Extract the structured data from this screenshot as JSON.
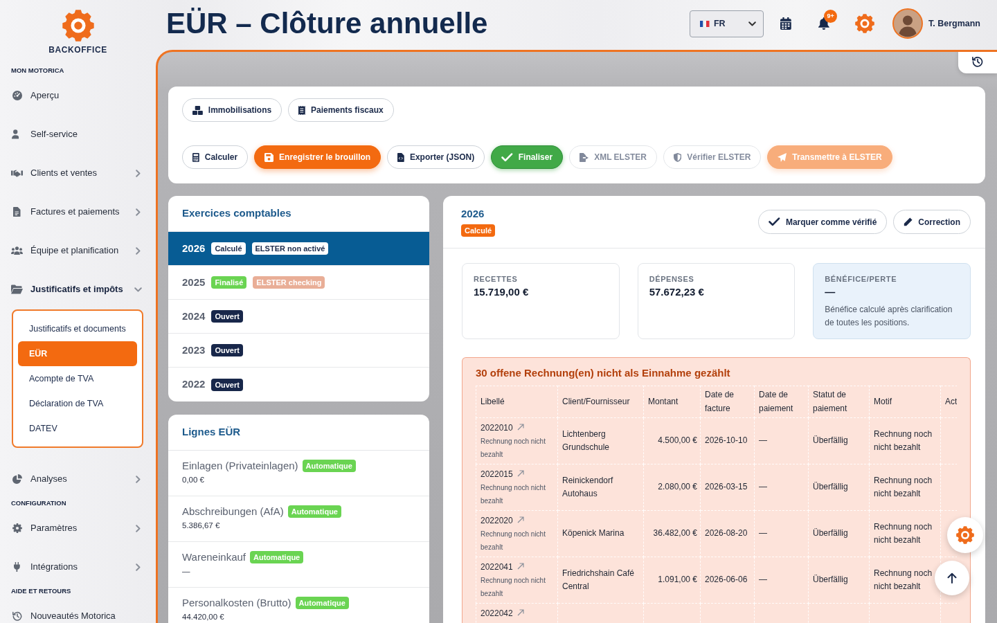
{
  "sidebar": {
    "brand": "BACKOFFICE",
    "sections": [
      {
        "label": "MON MOTORICA",
        "items": [
          {
            "label": "Aperçu",
            "kind": "link"
          },
          {
            "label": "Self-service",
            "kind": "link"
          },
          {
            "label": "Clients et ventes",
            "kind": "menu",
            "expanded": false
          },
          {
            "label": "Factures et paiements",
            "kind": "menu",
            "expanded": false
          },
          {
            "label": "Équipe et planification",
            "kind": "menu",
            "expanded": false
          },
          {
            "label": "Justificatifs et impôts",
            "kind": "menu",
            "expanded": true,
            "children": [
              {
                "label": "Justificatifs et documents",
                "selected": false
              },
              {
                "label": "EÜR",
                "selected": true
              },
              {
                "label": "Acompte de TVA",
                "selected": false
              },
              {
                "label": "Déclaration de TVA",
                "selected": false
              },
              {
                "label": "DATEV",
                "selected": false
              }
            ]
          },
          {
            "label": "Analyses",
            "kind": "menu",
            "expanded": false
          }
        ]
      },
      {
        "label": "CONFIGURATION",
        "items": [
          {
            "label": "Paramètres",
            "kind": "menu",
            "expanded": false
          },
          {
            "label": "Intégrations",
            "kind": "menu",
            "expanded": false
          }
        ]
      },
      {
        "label": "AIDE ET RETOURS",
        "items": [
          {
            "label": "Nouveautés Motorica",
            "kind": "link"
          }
        ]
      }
    ]
  },
  "header": {
    "title": "EÜR – Clôture annuelle",
    "language": "FR",
    "notifications_badge": "9+",
    "user_name": "T. Bergmann"
  },
  "toolbar": {
    "rows": [
      {
        "buttons": [
          {
            "label": "Immobilisations",
            "kind": "outline",
            "disabled": false
          },
          {
            "label": "Paiements fiscaux",
            "kind": "outline",
            "disabled": false
          }
        ]
      },
      {
        "buttons": [
          {
            "label": "Calculer",
            "kind": "outline",
            "disabled": false
          },
          {
            "label": "Enregistrer le brouillon",
            "kind": "primary",
            "disabled": false
          },
          {
            "label": "Exporter (JSON)",
            "kind": "outline",
            "disabled": false
          },
          {
            "label": "Finaliser",
            "kind": "success",
            "disabled": false
          },
          {
            "label": "XML ELSTER",
            "kind": "outline",
            "disabled": true
          },
          {
            "label": "Vérifier ELSTER",
            "kind": "outline",
            "disabled": true
          },
          {
            "label": "Transmettre à ELSTER",
            "kind": "primary",
            "disabled": true
          }
        ]
      }
    ]
  },
  "fiscal_years": {
    "title": "Exercices comptables",
    "items": [
      {
        "year": "2026",
        "selected": true,
        "badges": [
          {
            "label": "Calculé",
            "kind": "warning"
          },
          {
            "label": "ELSTER non activé",
            "kind": "secondary"
          }
        ]
      },
      {
        "year": "2025",
        "selected": false,
        "badges": [
          {
            "label": "Finalisé",
            "kind": "success"
          },
          {
            "label": "ELSTER checking",
            "kind": "pending"
          }
        ]
      },
      {
        "year": "2024",
        "selected": false,
        "badges": [
          {
            "label": "Ouvert",
            "kind": "dark"
          }
        ]
      },
      {
        "year": "2023",
        "selected": false,
        "badges": [
          {
            "label": "Ouvert",
            "kind": "dark"
          }
        ]
      },
      {
        "year": "2022",
        "selected": false,
        "badges": [
          {
            "label": "Ouvert",
            "kind": "dark"
          }
        ]
      }
    ]
  },
  "eur_lines": {
    "title": "Lignes EÜR",
    "items": [
      {
        "label": "Einlagen (Privateinlagen)",
        "badge": "Automatique",
        "amount": "0,00 €"
      },
      {
        "label": "Abschreibungen (AfA)",
        "badge": "Automatique",
        "amount": "5.386,67 €"
      },
      {
        "label": "Wareneinkauf",
        "badge": "Automatique",
        "amount": "—"
      },
      {
        "label": "Personalkosten (Brutto)",
        "badge": "Automatique",
        "amount": "44.420,00 €"
      }
    ]
  },
  "year_detail": {
    "year": "2026",
    "status": {
      "label": "Calculé",
      "kind": "warning"
    },
    "actions": [
      "Marquer comme vérifié",
      "Correction"
    ],
    "stats": [
      {
        "label": "RECETTES",
        "value": "15.719,00 €",
        "kind": "plain"
      },
      {
        "label": "DÉPENSES",
        "value": "57.672,23 €",
        "kind": "plain"
      },
      {
        "label": "BÉNÉFICE/PERTE",
        "value": "—",
        "note": "Bénéfice calculé après clarification de toutes les positions.",
        "kind": "info"
      }
    ],
    "open_invoices": {
      "title": "30 offene Rechnung(en) nicht als Einnahme gezählt",
      "columns": [
        "Libellé",
        "Client/Fournisseur",
        "Montant",
        "Date de facture",
        "Date de paiement",
        "Statut de paiement",
        "Motif",
        "Act"
      ],
      "rows": [
        {
          "label": "2022010",
          "note": "Rechnung noch nicht bezahlt",
          "client": "Lichtenberg Grundschule",
          "amount": "4.500,00 €",
          "invoice_date": "2026-10-10",
          "payment_date": "—",
          "payment_status": "Überfällig",
          "reason": "Rechnung noch nicht bezahlt"
        },
        {
          "label": "2022015",
          "note": "Rechnung noch nicht bezahlt",
          "client": "Reinickendorf Autohaus",
          "amount": "2.080,00 €",
          "invoice_date": "2026-03-15",
          "payment_date": "—",
          "payment_status": "Überfällig",
          "reason": "Rechnung noch nicht bezahlt"
        },
        {
          "label": "2022020",
          "note": "Rechnung noch nicht bezahlt",
          "client": "Köpenick Marina",
          "amount": "36.482,00 €",
          "invoice_date": "2026-08-20",
          "payment_date": "—",
          "payment_status": "Überfällig",
          "reason": "Rechnung noch nicht bezahlt"
        },
        {
          "label": "2022041",
          "note": "Rechnung noch nicht bezahlt",
          "client": "Friedrichshain Café Central",
          "amount": "1.091,00 €",
          "invoice_date": "2026-06-06",
          "payment_date": "—",
          "payment_status": "Überfällig",
          "reason": "Rechnung noch nicht bezahlt"
        },
        {
          "label": "2022042"
        }
      ]
    }
  }
}
